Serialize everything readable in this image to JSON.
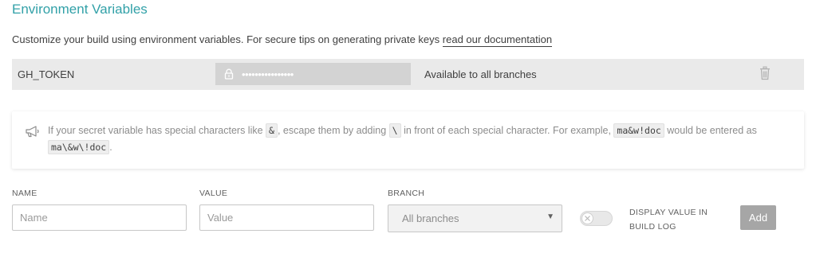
{
  "header": {
    "title": "Environment Variables",
    "intro_text": "Customize your build using environment variables. For secure tips on generating private keys ",
    "intro_link": "read our documentation"
  },
  "variables": [
    {
      "name": "GH_TOKEN",
      "value_masked": "••••••••••••••••",
      "branch": "Available to all branches"
    }
  ],
  "notice": {
    "part1": "If your secret variable has special characters like ",
    "code1": "&",
    "part2": ", escape them by adding ",
    "code2": "\\",
    "part3": " in front of each special character. For example, ",
    "code3": "ma&w!doc",
    "part4": " would be entered as ",
    "code4": "ma\\&w\\!doc",
    "part5": "."
  },
  "form": {
    "name_label": "NAME",
    "name_placeholder": "Name",
    "value_label": "VALUE",
    "value_placeholder": "Value",
    "branch_label": "BRANCH",
    "branch_selected": "All branches",
    "display_label": "DISPLAY VALUE IN BUILD LOG",
    "display_enabled": false,
    "add_label": "Add"
  },
  "colors": {
    "accent": "#32a1a8",
    "row_background": "#eaeaea",
    "masked_field": "#d3d3d3",
    "add_button": "#a6a6a6"
  }
}
